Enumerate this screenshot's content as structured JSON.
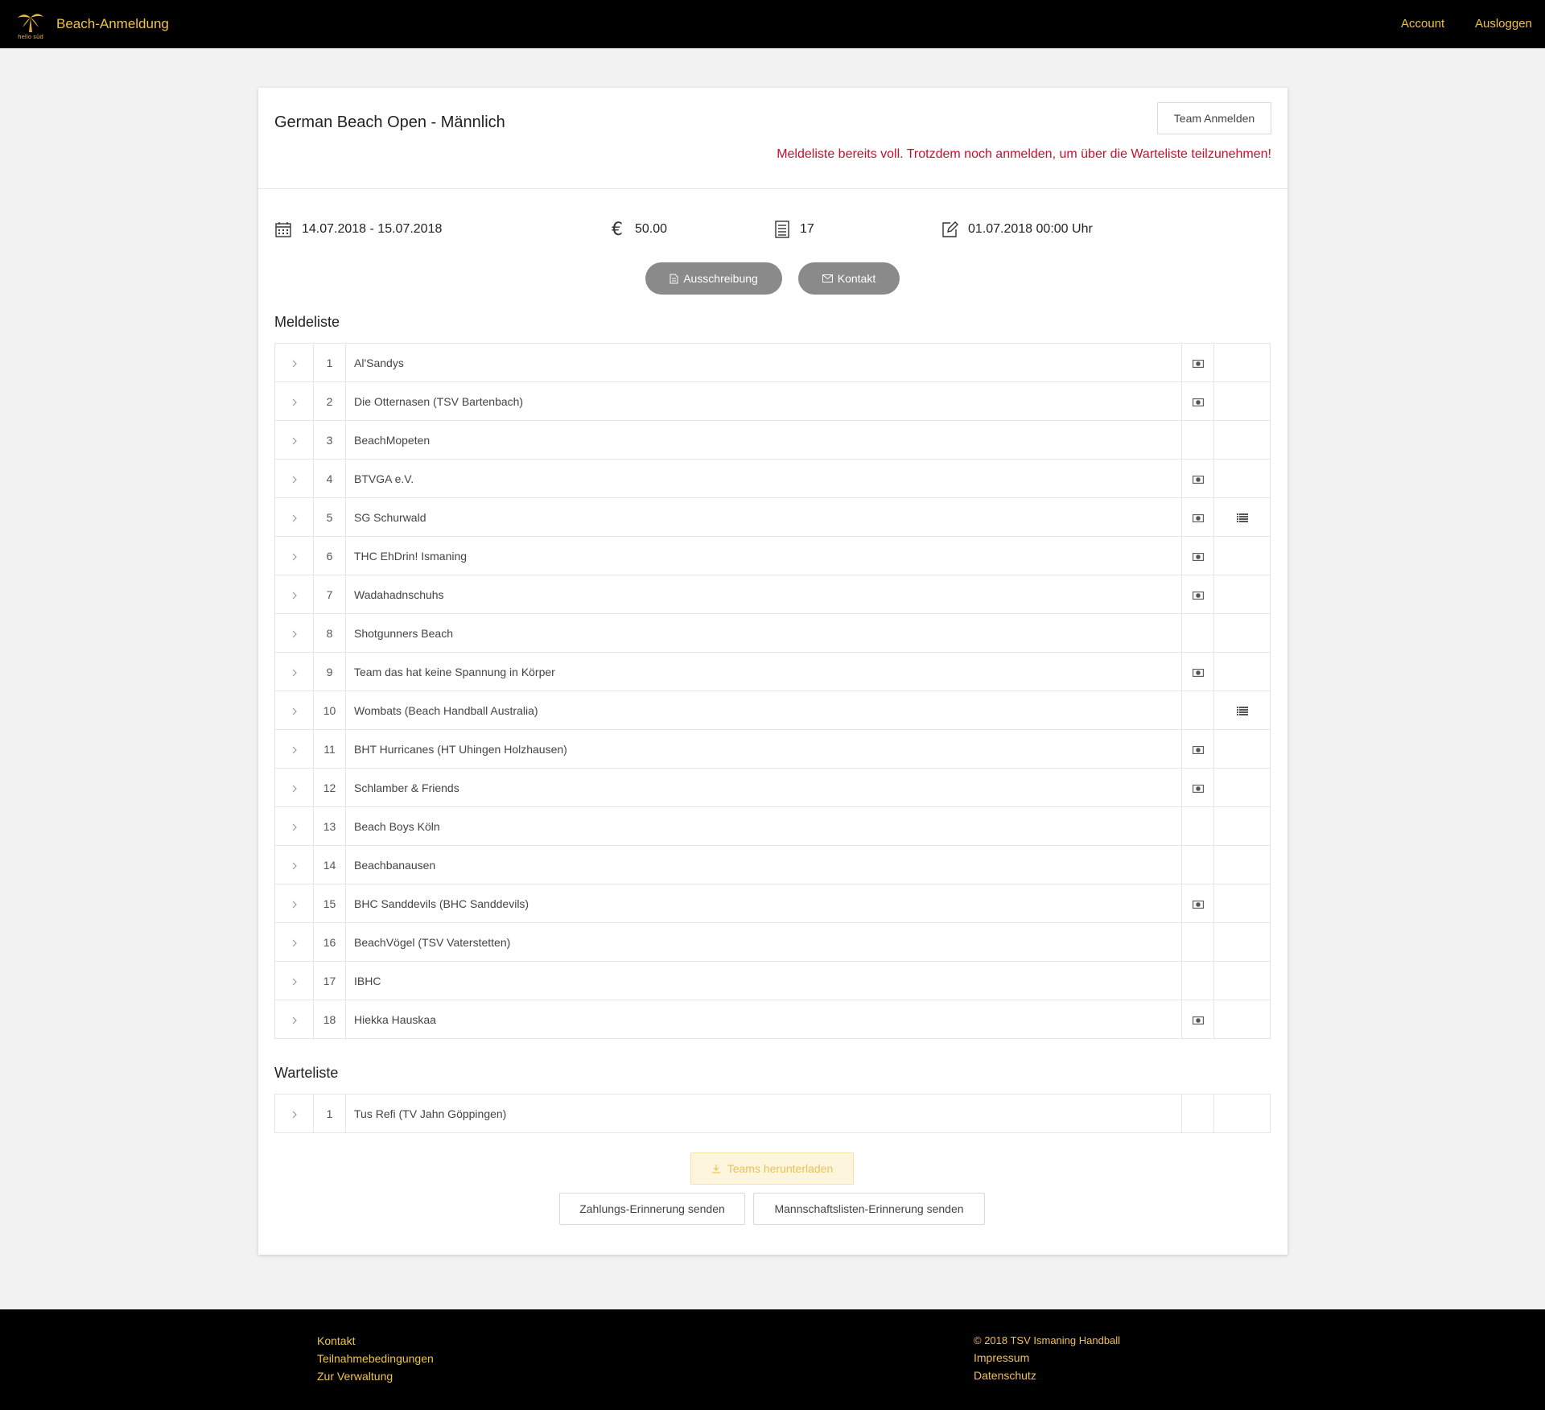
{
  "navbar": {
    "brand": "Beach-Anmeldung",
    "account": "Account",
    "logout": "Ausloggen",
    "logo_text": "hello süd"
  },
  "event": {
    "title": "German Beach Open - Männlich",
    "register_button": "Team Anmelden",
    "warning": "Meldeliste bereits voll. Trotzdem noch anmelden, um über die Warteliste teilzunehmen!",
    "dates": "14.07.2018 - 15.07.2018",
    "fee": "50.00",
    "slots": "17",
    "deadline": "01.07.2018 00:00 Uhr",
    "btn_tender": "Ausschreibung",
    "btn_contact": "Kontakt"
  },
  "registration_list": {
    "title": "Meldeliste",
    "rows": [
      {
        "num": "1",
        "name": "Al'Sandys",
        "paid": true,
        "list": false
      },
      {
        "num": "2",
        "name": "Die Otternasen (TSV Bartenbach)",
        "paid": true,
        "list": false
      },
      {
        "num": "3",
        "name": "BeachMopeten",
        "paid": false,
        "list": false
      },
      {
        "num": "4",
        "name": "BTVGA e.V.",
        "paid": true,
        "list": false
      },
      {
        "num": "5",
        "name": "SG Schurwald",
        "paid": true,
        "list": true
      },
      {
        "num": "6",
        "name": "THC EhDrin! Ismaning",
        "paid": true,
        "list": false
      },
      {
        "num": "7",
        "name": "Wadahadnschuhs",
        "paid": true,
        "list": false
      },
      {
        "num": "8",
        "name": "Shotgunners Beach",
        "paid": false,
        "list": false
      },
      {
        "num": "9",
        "name": "Team das hat keine Spannung in Körper",
        "paid": true,
        "list": false
      },
      {
        "num": "10",
        "name": "Wombats (Beach Handball Australia)",
        "paid": false,
        "list": true
      },
      {
        "num": "11",
        "name": "BHT Hurricanes (HT Uhingen Holzhausen)",
        "paid": true,
        "list": false
      },
      {
        "num": "12",
        "name": "Schlamber & Friends",
        "paid": true,
        "list": false
      },
      {
        "num": "13",
        "name": "Beach Boys Köln",
        "paid": false,
        "list": false
      },
      {
        "num": "14",
        "name": "Beachbanausen",
        "paid": false,
        "list": false
      },
      {
        "num": "15",
        "name": "BHC Sanddevils (BHC Sanddevils)",
        "paid": true,
        "list": false
      },
      {
        "num": "16",
        "name": "BeachVögel (TSV Vaterstetten)",
        "paid": false,
        "list": false
      },
      {
        "num": "17",
        "name": "IBHC",
        "paid": false,
        "list": false
      },
      {
        "num": "18",
        "name": "Hiekka Hauskaa",
        "paid": true,
        "list": false
      }
    ]
  },
  "waiting_list": {
    "title": "Warteliste",
    "rows": [
      {
        "num": "1",
        "name": "Tus Refi (TV Jahn Göppingen)",
        "paid": false,
        "list": false
      }
    ]
  },
  "actions": {
    "download": "Teams herunterladen",
    "payment_reminder": "Zahlungs-Erinnerung senden",
    "roster_reminder": "Mannschaftslisten-Erinnerung senden"
  },
  "footer": {
    "contact": "Kontakt",
    "terms": "Teilnahmebedingungen",
    "admin": "Zur Verwaltung",
    "copyright": "© 2018 TSV Ismaning Handball",
    "imprint": "Impressum",
    "privacy": "Datenschutz"
  },
  "colors": {
    "accent": "#f0c24b",
    "warning": "#c8102e",
    "navbar_bg": "#000000",
    "pill_bg": "#8a8a8a"
  },
  "icons": {
    "calendar": "calendar-icon",
    "euro": "euro-icon",
    "slots": "list-document-icon",
    "deadline": "edit-icon",
    "expand": "chevron-right-icon",
    "paid": "money-icon",
    "roster": "list-icon"
  }
}
